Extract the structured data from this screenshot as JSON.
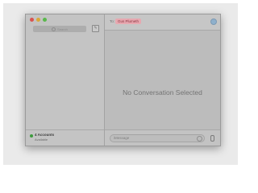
{
  "sidebar": {
    "search_placeholder": "Search",
    "compose_icon": "compose-icon",
    "accounts_title": "4 Accounts",
    "accounts_status": "Available"
  },
  "header": {
    "to_label": "To:",
    "recipient": "Gus Plumeth"
  },
  "main": {
    "empty_message": "No Conversation Selected"
  },
  "composer": {
    "placeholder": "iMessage"
  },
  "colors": {
    "recipient_chip": "#e7a8b0",
    "status_available": "#3d9a3d"
  }
}
